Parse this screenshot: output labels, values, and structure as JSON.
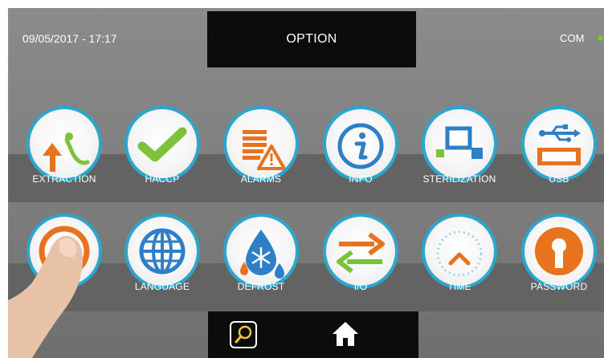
{
  "status": {
    "datetime": "09/05/2017 - 17:17",
    "com_label": "COM",
    "com_color": "#7cc23a"
  },
  "header": {
    "title": "OPTION"
  },
  "row1": [
    {
      "label": "EXTRACTION",
      "icon": "extraction-icon"
    },
    {
      "label": "HACCP",
      "icon": "checkmark-icon"
    },
    {
      "label": "ALARMS",
      "icon": "alarm-warning-icon"
    },
    {
      "label": "INFO",
      "icon": "info-icon"
    },
    {
      "label": "STERILIZATION",
      "icon": "sterilization-icon"
    },
    {
      "label": "USB",
      "icon": "usb-icon"
    }
  ],
  "row2": [
    {
      "label": "",
      "icon": "power-ring-icon"
    },
    {
      "label": "LANGUAGE",
      "icon": "globe-icon"
    },
    {
      "label": "DEFROST",
      "icon": "defrost-icon"
    },
    {
      "label": "I/O",
      "icon": "io-arrows-icon"
    },
    {
      "label": "TIME",
      "icon": "time-dial-icon"
    },
    {
      "label": "PASSWORD",
      "icon": "keyhole-icon"
    }
  ],
  "footer": {
    "search_icon": "search-icon",
    "home_icon": "home-icon"
  },
  "colors": {
    "ring": "#2aa6cf",
    "orange": "#e8731e",
    "green": "#7cc23a",
    "blue": "#2f7fc8"
  }
}
